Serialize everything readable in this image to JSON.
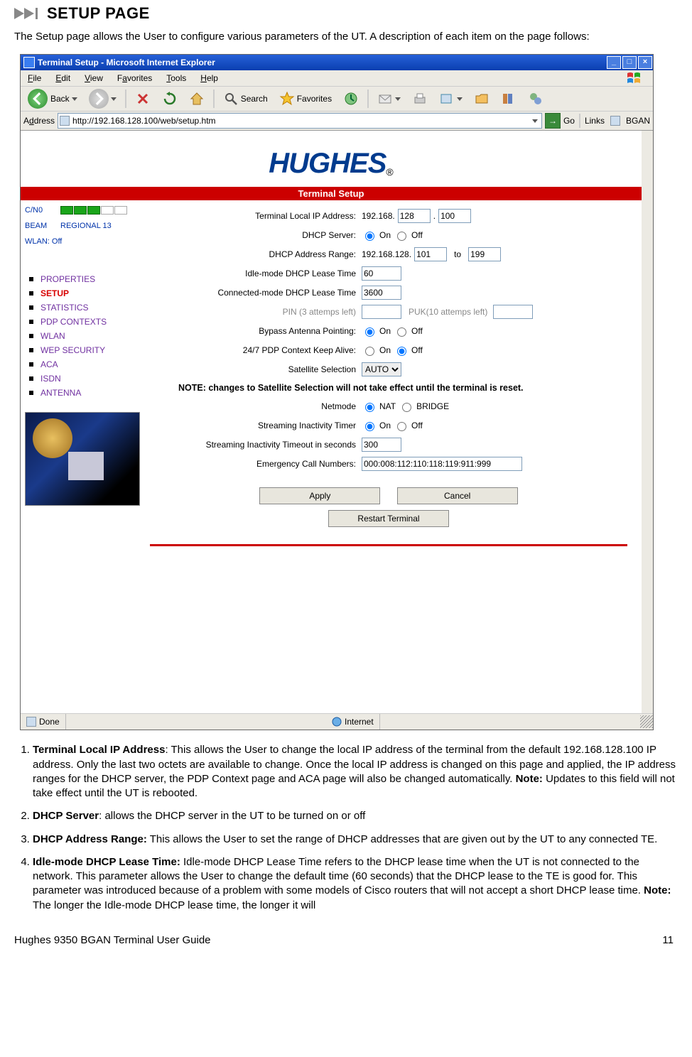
{
  "heading": "SETUP PAGE",
  "intro": "The Setup page allows the User to configure various parameters of the UT.  A description of each item on the page follows:",
  "browser": {
    "title": "Terminal Setup - Microsoft Internet Explorer",
    "menu": {
      "file": "File",
      "edit": "Edit",
      "view": "View",
      "favorites": "Favorites",
      "tools": "Tools",
      "help": "Help"
    },
    "toolbar": {
      "back": "Back",
      "search": "Search",
      "favorites": "Favorites"
    },
    "address_label": "Address",
    "url": "http://192.168.128.100/web/setup.htm",
    "go": "Go",
    "links_label": "Links",
    "links_item": "BGAN",
    "status_done": "Done",
    "status_zone": "Internet"
  },
  "page": {
    "logo": "HUGHES",
    "banner": "Terminal Setup",
    "status": {
      "cn0_label": "C/N0",
      "beam_label": "BEAM",
      "beam_value": "REGIONAL 13",
      "wlan": "WLAN: Off"
    },
    "nav": [
      "PROPERTIES",
      "SETUP",
      "STATISTICS",
      "PDP CONTEXTS",
      "WLAN",
      "WEP SECURITY",
      "ACA",
      "ISDN",
      "ANTENNA"
    ],
    "form": {
      "ip_label": "Terminal Local IP Address:",
      "ip_prefix": "192.168.",
      "ip_oct3": "128",
      "ip_dot": ".",
      "ip_oct4": "100",
      "dhcp_label": "DHCP Server:",
      "on": "On",
      "off": "Off",
      "range_label": "DHCP Address Range:",
      "range_prefix": "192.168.128.",
      "range_from": "101",
      "to": "to",
      "range_to": "199",
      "idle_label": "Idle-mode DHCP Lease Time",
      "idle_val": "60",
      "conn_label": "Connected-mode DHCP Lease Time",
      "conn_val": "3600",
      "pin_label": "PIN (3 attemps left)",
      "puk_label": "PUK(10 attemps left)",
      "bypass_label": "Bypass Antenna Pointing:",
      "keep_label": "24/7 PDP Context Keep Alive:",
      "sat_label": "Satellite Selection",
      "sat_val": "AUTO",
      "note": "NOTE: changes to Satellite Selection will not take effect until the terminal is reset.",
      "netmode_label": "Netmode",
      "nat": "NAT",
      "bridge": "BRIDGE",
      "stimer_label": "Streaming Inactivity Timer",
      "stimeout_label": "Streaming Inactivity Timeout in seconds",
      "stimeout_val": "300",
      "ecn_label": "Emergency Call Numbers:",
      "ecn_val": "000:008:112:110:118:119:911:999",
      "apply": "Apply",
      "cancel": "Cancel",
      "restart": "Restart Terminal"
    }
  },
  "list": {
    "i1": {
      "b": "Terminal Local IP Address",
      "t": ":  This allows the User to change the local IP address of the terminal from the default 192.168.128.100 IP address.  Only the last two octets are available to change.  Once the local IP address is changed on this page and applied, the IP address ranges for the DHCP server, the PDP Context page and ACA page will also be changed automatically.  ",
      "nb": "Note:",
      "nt": "  Updates to this field will not take effect until the UT is rebooted."
    },
    "i2": {
      "b": "DHCP Server",
      "t": ": allows the DHCP server in the UT to be turned on or off"
    },
    "i3": {
      "b": "DHCP Address Range:",
      "t": "  This allows the User to set the range of DHCP addresses that are given out by the UT to any connected TE."
    },
    "i4": {
      "b": "Idle-mode DHCP Lease Time:",
      "t": "  Idle-mode DHCP Lease Time refers to the DHCP lease time when the UT is not connected to the network.  This parameter allows the User to change the default time (60 seconds) that the DHCP lease to the TE is good for.  This parameter was introduced because of a problem with some models of Cisco routers that will not accept a short DHCP lease time.  ",
      "nb": "Note:",
      "nt": "  The longer the Idle-mode DHCP lease time, the longer it will"
    }
  },
  "footer": {
    "left": "Hughes 9350 BGAN Terminal User Guide",
    "right": "11"
  }
}
